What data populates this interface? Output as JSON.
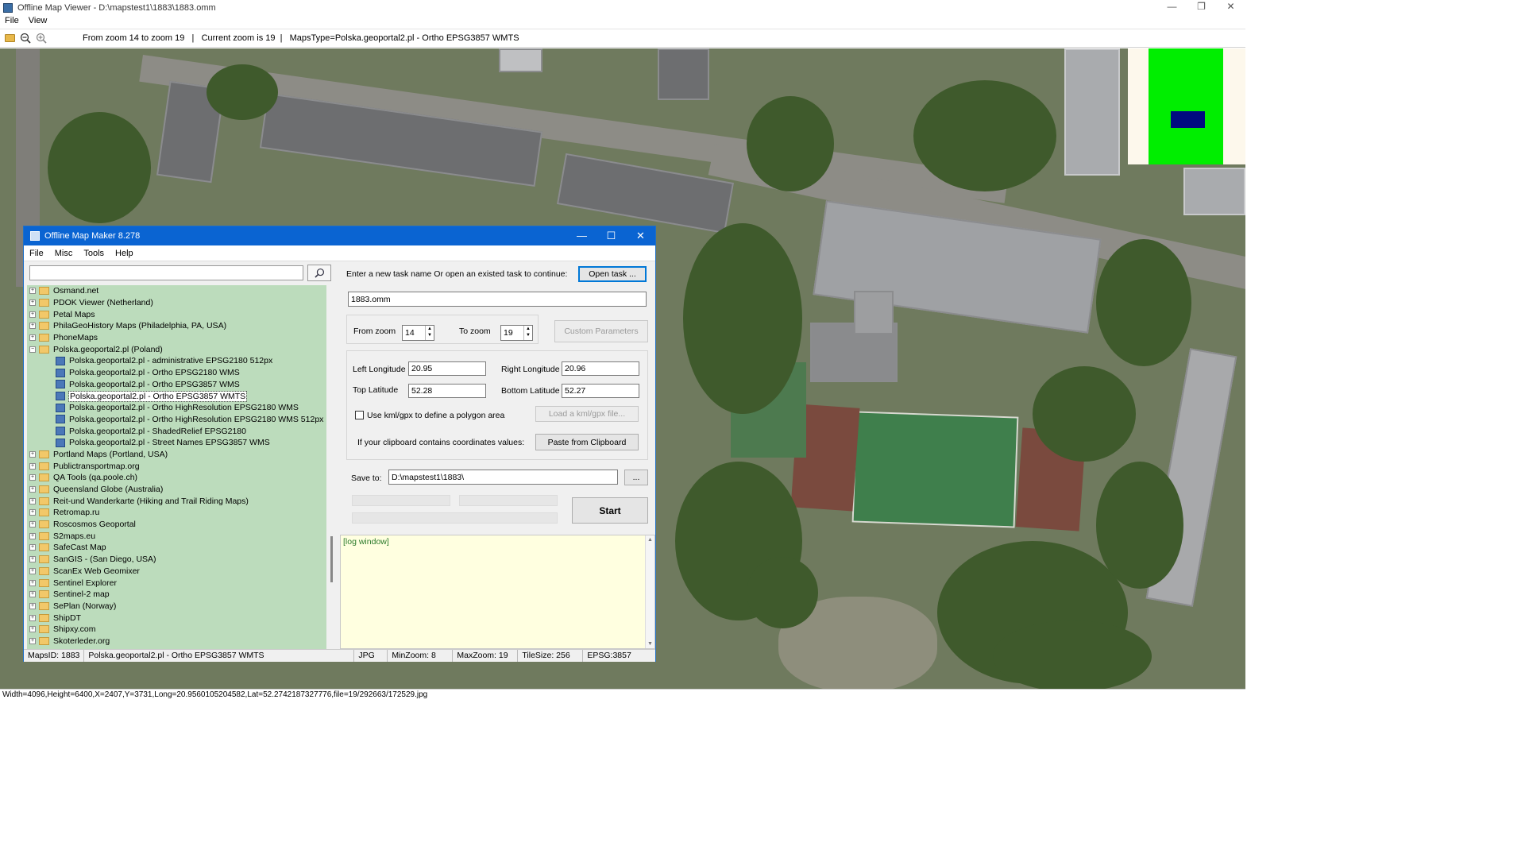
{
  "viewer": {
    "title": "Offline Map Viewer - D:\\mapstest1\\1883\\1883.omm",
    "window_controls": {
      "minimize": "—",
      "restore": "❐",
      "close": "✕"
    },
    "menu": [
      "File",
      "View"
    ],
    "toolbar": {
      "status_text": "From zoom 14 to zoom 19   |   Current zoom is 19  |   MapsType=Polska.geoportal2.pl - Ortho EPSG3857 WMTS"
    },
    "statusbar": "Width=4096,Height=6400,X=2407,Y=3731,Long=20.9560105204582,Lat=52.2742187327776,file=19/292663/172529.jpg"
  },
  "colors": {
    "dialog_title": "#0a64d2",
    "tree_bg": "#bcdcbc",
    "log_bg": "#ffffe0",
    "overview_green": "#00ee00",
    "overview_marker": "#000b80"
  },
  "dialog": {
    "title": "Offline Map Maker 8.278",
    "window_controls": {
      "minimize": "—",
      "maximize": "☐",
      "close": "✕"
    },
    "menu": [
      "File",
      "Misc",
      "Tools",
      "Help"
    ],
    "search": {
      "value": "",
      "button_icon": "search-icon"
    },
    "tree": [
      {
        "label": "Osmand.net",
        "expanded": false
      },
      {
        "label": "PDOK Viewer (Netherland)",
        "expanded": false
      },
      {
        "label": "Petal Maps",
        "expanded": false
      },
      {
        "label": "PhilaGeoHistory Maps (Philadelphia, PA, USA)",
        "expanded": false
      },
      {
        "label": "PhoneMaps",
        "expanded": false
      },
      {
        "label": "Polska.geoportal2.pl (Poland)",
        "expanded": true,
        "children": [
          {
            "label": "Polska.geoportal2.pl - administrative EPSG2180 512px"
          },
          {
            "label": "Polska.geoportal2.pl - Ortho EPSG2180 WMS"
          },
          {
            "label": "Polska.geoportal2.pl - Ortho EPSG3857 WMS"
          },
          {
            "label": "Polska.geoportal2.pl - Ortho EPSG3857 WMTS",
            "selected": true
          },
          {
            "label": "Polska.geoportal2.pl - Ortho HighResolution EPSG2180 WMS"
          },
          {
            "label": "Polska.geoportal2.pl - Ortho HighResolution EPSG2180 WMS 512px"
          },
          {
            "label": "Polska.geoportal2.pl - ShadedRelief EPSG2180"
          },
          {
            "label": "Polska.geoportal2.pl - Street Names EPSG3857 WMS"
          }
        ]
      },
      {
        "label": "Portland Maps (Portland, USA)",
        "expanded": false
      },
      {
        "label": "Publictransportmap.org",
        "expanded": false
      },
      {
        "label": "QA Tools (qa.poole.ch)",
        "expanded": false
      },
      {
        "label": "Queensland Globe (Australia)",
        "expanded": false
      },
      {
        "label": "Reit-und Wanderkarte (Hiking and Trail Riding Maps)",
        "expanded": false
      },
      {
        "label": "Retromap.ru",
        "expanded": false
      },
      {
        "label": "Roscosmos Geoportal",
        "expanded": false
      },
      {
        "label": "S2maps.eu",
        "expanded": false
      },
      {
        "label": "SafeCast Map",
        "expanded": false
      },
      {
        "label": "SanGIS - (San Diego, USA)",
        "expanded": false
      },
      {
        "label": "ScanEx Web Geomixer",
        "expanded": false
      },
      {
        "label": "Sentinel Explorer",
        "expanded": false
      },
      {
        "label": "Sentinel-2 map",
        "expanded": false
      },
      {
        "label": "SePlan (Norway)",
        "expanded": false
      },
      {
        "label": "ShipDT",
        "expanded": false
      },
      {
        "label": "Shipxy.com",
        "expanded": false
      },
      {
        "label": "Skoterleder.org",
        "expanded": false
      }
    ],
    "task": {
      "prompt": "Enter a new task name Or open an existed task to continue:",
      "open_button": "Open task ...",
      "name_value": "1883.omm"
    },
    "zoom": {
      "from_label": "From zoom",
      "from_value": "14",
      "to_label": "To zoom",
      "to_value": "19",
      "custom_button": "Custom Parameters"
    },
    "coords": {
      "left_lon_label": "Left Longitude",
      "left_lon_value": "20.95",
      "right_lon_label": "Right Longitude",
      "right_lon_value": "20.96",
      "top_lat_label": "Top Latitude",
      "top_lat_value": "52.28",
      "bottom_lat_label": "Bottom Latitude",
      "bottom_lat_value": "52.27",
      "kml_checkbox_label": "Use kml/gpx to define a polygon area",
      "kml_checked": false,
      "load_kml_button": "Load a kml/gpx file...",
      "clipboard_label": "If your clipboard contains coordinates values:",
      "paste_button": "Paste from Clipboard"
    },
    "save": {
      "label": "Save to:",
      "value": "D:\\mapstest1\\1883\\",
      "browse_button": "..."
    },
    "start_button": "Start",
    "log_text": "[log window]",
    "status": {
      "maps_id": "MapsID: 1883",
      "maps_name": "Polska.geoportal2.pl - Ortho EPSG3857 WMTS",
      "format": "JPG",
      "min_zoom": "MinZoom: 8",
      "max_zoom": "MaxZoom: 19",
      "tile_size": "TileSize: 256",
      "epsg": "EPSG:3857"
    }
  }
}
